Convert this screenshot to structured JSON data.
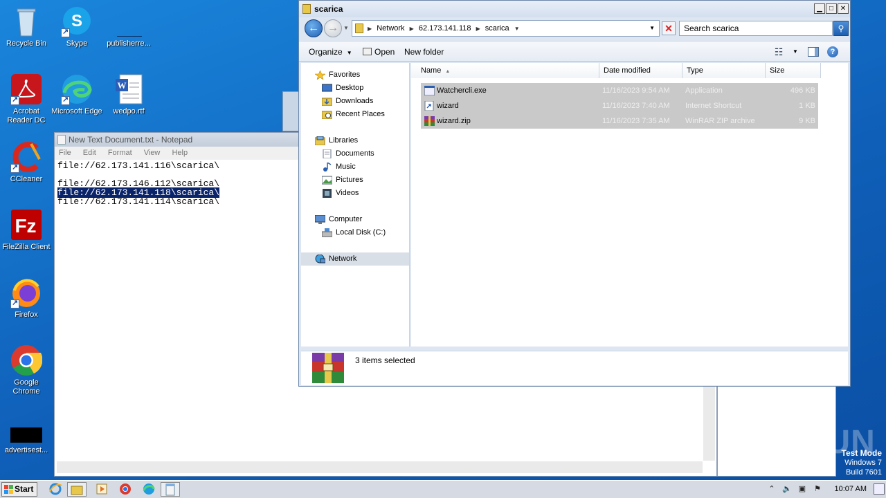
{
  "desktop": {
    "icons": [
      {
        "label": "Recycle Bin"
      },
      {
        "label": "Skype"
      },
      {
        "label": "publisherre..."
      },
      {
        "label": "Acrobat Reader DC"
      },
      {
        "label": "Microsoft Edge"
      },
      {
        "label": "wedpo.rtf"
      },
      {
        "label": "CCleaner"
      },
      {
        "label": "FileZilla Client"
      },
      {
        "label": "Firefox"
      },
      {
        "label": "Google Chrome"
      },
      {
        "label": "advertisest..."
      }
    ]
  },
  "notepad": {
    "title": "New Text Document.txt - Notepad",
    "menu": [
      "File",
      "Edit",
      "Format",
      "View",
      "Help"
    ],
    "lines": [
      "file://62.173.141.116\\scarica\\",
      "",
      "file://62.173.146.112\\scarica\\",
      "file://62.173.141.118\\scarica\\",
      "file://62.173.141.114\\scarica\\"
    ]
  },
  "explorer": {
    "title": "scarica",
    "breadcrumb": [
      "Network",
      "62.173.141.118",
      "scarica"
    ],
    "search_placeholder": "Search scarica",
    "toolbar": {
      "organize": "Organize",
      "open": "Open",
      "new_folder": "New folder"
    },
    "nav": {
      "favorites": "Favorites",
      "desktop": "Desktop",
      "downloads": "Downloads",
      "recent": "Recent Places",
      "libraries": "Libraries",
      "documents": "Documents",
      "music": "Music",
      "pictures": "Pictures",
      "videos": "Videos",
      "computer": "Computer",
      "local_disk": "Local Disk (C:)",
      "network": "Network"
    },
    "columns": {
      "name": "Name",
      "date": "Date modified",
      "type": "Type",
      "size": "Size"
    },
    "files": [
      {
        "name": "Watchercli.exe",
        "date": "11/16/2023 9:54 AM",
        "type": "Application",
        "size": "496 KB",
        "icon": "application-icon"
      },
      {
        "name": "wizard",
        "date": "11/16/2023 7:40 AM",
        "type": "Internet Shortcut",
        "size": "1 KB",
        "icon": "shortcut-icon"
      },
      {
        "name": "wizard.zip",
        "date": "11/16/2023 7:35 AM",
        "type": "WinRAR ZIP archive",
        "size": "9 KB",
        "icon": "winrar-icon"
      }
    ],
    "status": "3 items selected"
  },
  "watermark": {
    "text": "ANY RUN"
  },
  "testmode": {
    "line1": "Test Mode",
    "line2": "Windows 7",
    "line3": "Build 7601"
  },
  "taskbar": {
    "start": "Start",
    "clock": "10:07 AM"
  }
}
